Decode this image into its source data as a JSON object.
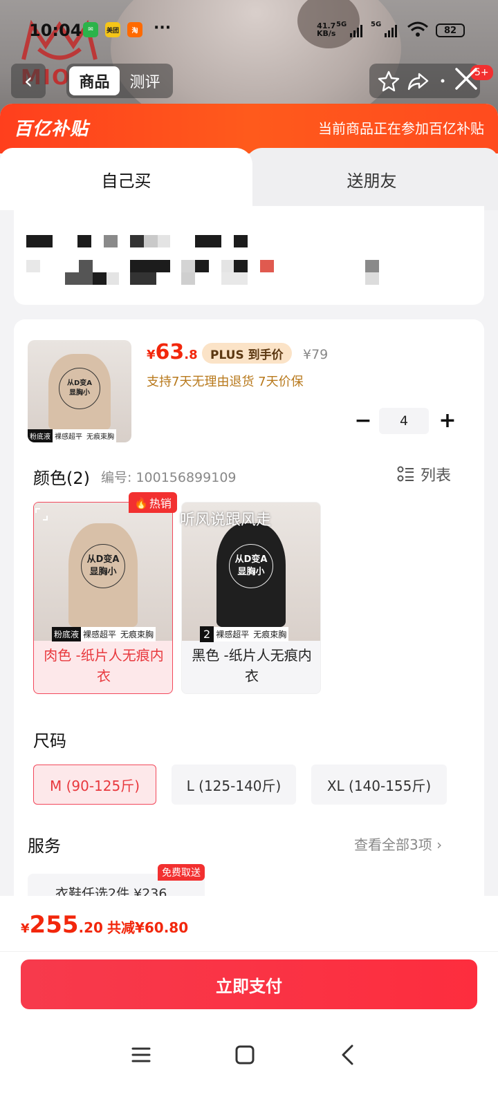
{
  "status_bar": {
    "time": "10:04",
    "apps": [
      "微信",
      "美团",
      "淘"
    ],
    "more": "···",
    "net_speed_top": "41.7",
    "net_speed_bottom": "KB/s",
    "sig1": "5G",
    "sig2": "5G",
    "battery": "82"
  },
  "brand_bg": "MIOW",
  "nav": {
    "tab_goods": "商品",
    "tab_review": "测评",
    "msg_badge": "5+"
  },
  "promo": {
    "logo": "百亿补贴",
    "text": "当前商品正在参加百亿补贴"
  },
  "buy_tabs": {
    "self": "自己买",
    "gift": "送朋友"
  },
  "product": {
    "thumb_tag1": "粉底液",
    "thumb_tag2": "裸感超平",
    "thumb_tag3": "无痕束胸",
    "thumb_circle_l1": "从D变A",
    "thumb_circle_l2": "显胸小",
    "price_symbol": "¥",
    "price_int": "63",
    "price_dec": ".8",
    "plus_label": "PLUS 到手价",
    "old_price": "¥79",
    "support": "支持7天无理由退货  7天价保",
    "qty_minus": "−",
    "qty_value": "4",
    "qty_plus": "+"
  },
  "color_section": {
    "title": "颜色(2)",
    "code": "编号: 100156899109",
    "list_label": "列表",
    "hot_label": "热销",
    "watermark": "听风说跟风走",
    "options": [
      {
        "label": "肉色 -纸片人无痕内衣",
        "tag1": "粉底液",
        "tag2": "裸感超平",
        "tag3": "无痕束胸"
      },
      {
        "label": "黑色 -纸片人无痕内衣",
        "tag1": "2",
        "tag2": "裸感超平",
        "tag3": "无痕束胸"
      }
    ]
  },
  "size_section": {
    "title": "尺码",
    "options": [
      "M (90-125斤)",
      "L (125-140斤)",
      "XL (140-155斤)"
    ]
  },
  "service_section": {
    "title": "服务",
    "more": "查看全部3项  ›",
    "free_tag": "免费取送",
    "card_text": "衣鞋任选2件  ¥236"
  },
  "footer": {
    "symbol": "¥",
    "total_int": "255",
    "total_dec": ".20",
    "reduce": "共减¥60.80",
    "pay": "立即支付"
  },
  "colors": {
    "accent": "#f2270c",
    "promo": "#ff4b1e",
    "pay": "#fd2d3e"
  }
}
